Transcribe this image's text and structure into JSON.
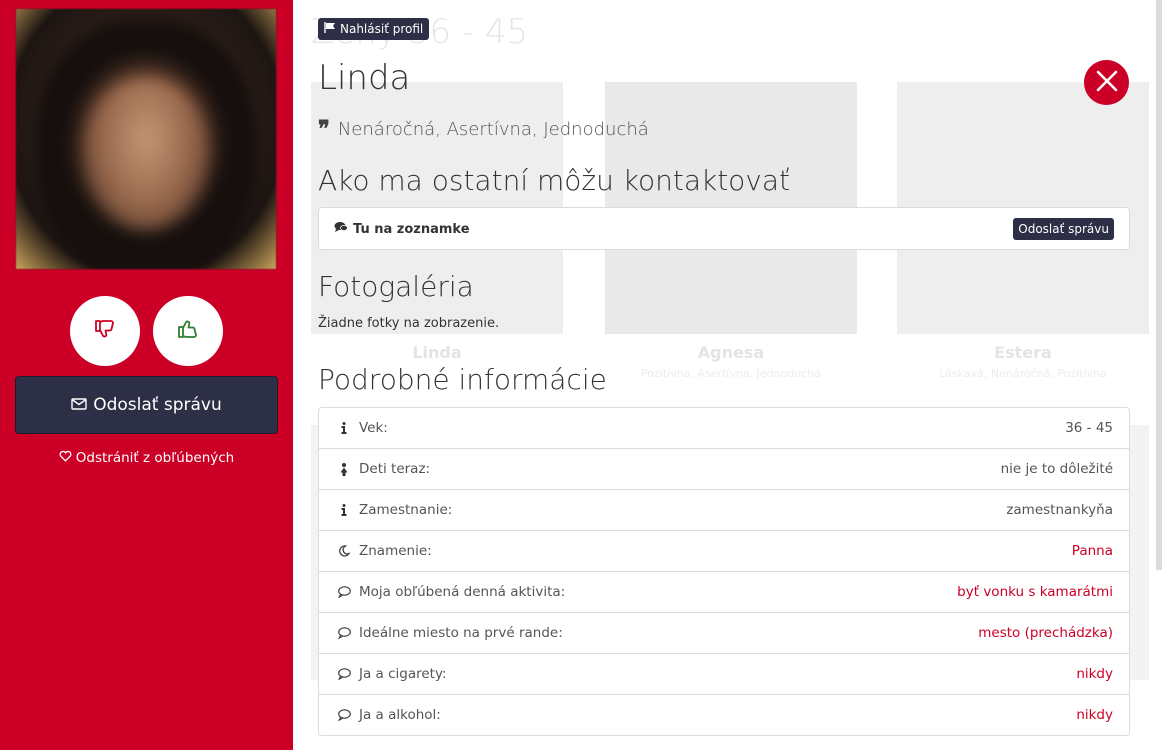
{
  "background": {
    "heading": "Zeny 36 - 45",
    "cards": [
      {
        "name": "Linda",
        "sub": ""
      },
      {
        "name": "Agnesa",
        "sub": "Pozitívna, Asertívna, Jednoduchá"
      },
      {
        "name": "Estera",
        "sub": "Láskavá, Nenáročná, Pozitívna"
      }
    ]
  },
  "sidebar": {
    "send_message_label": "Odoslať správu",
    "favorite_label": "Odstrániť z obľúbených"
  },
  "profile": {
    "report_label": "Nahlásiť profil",
    "name": "Linda",
    "traits": "Nenáročná, Asertívna, Jednoduchá",
    "contact_heading": "Ako ma ostatní môžu kontaktovať",
    "contact_channel": "Tu na zoznamke",
    "contact_button": "Odoslať správu",
    "gallery_heading": "Fotogaléria",
    "gallery_empty": "Žiadne fotky na zobrazenie.",
    "details_heading": "Podrobné informácie"
  },
  "details": [
    {
      "icon": "info-icon",
      "label": "Vek:",
      "value": "36 - 45",
      "accent": false
    },
    {
      "icon": "child-icon",
      "label": "Deti teraz:",
      "value": "nie je to dôležité",
      "accent": false
    },
    {
      "icon": "info-icon",
      "label": "Zamestnanie:",
      "value": "zamestnankyňa",
      "accent": false
    },
    {
      "icon": "moon-icon",
      "label": "Znamenie:",
      "value": "Panna",
      "accent": true
    },
    {
      "icon": "comment-icon",
      "label": "Moja obľúbená denná aktivita:",
      "value": "byť vonku s kamarátmi",
      "accent": true
    },
    {
      "icon": "comment-icon",
      "label": "Ideálne miesto na prvé rande:",
      "value": "mesto (prechádzka)",
      "accent": true
    },
    {
      "icon": "comment-icon",
      "label": "Ja a cigarety:",
      "value": "nikdy",
      "accent": true
    },
    {
      "icon": "comment-icon",
      "label": "Ja a alkohol:",
      "value": "nikdy",
      "accent": true
    }
  ],
  "colors": {
    "brand_red": "#cc0026",
    "dark_button": "#2c2f45"
  }
}
